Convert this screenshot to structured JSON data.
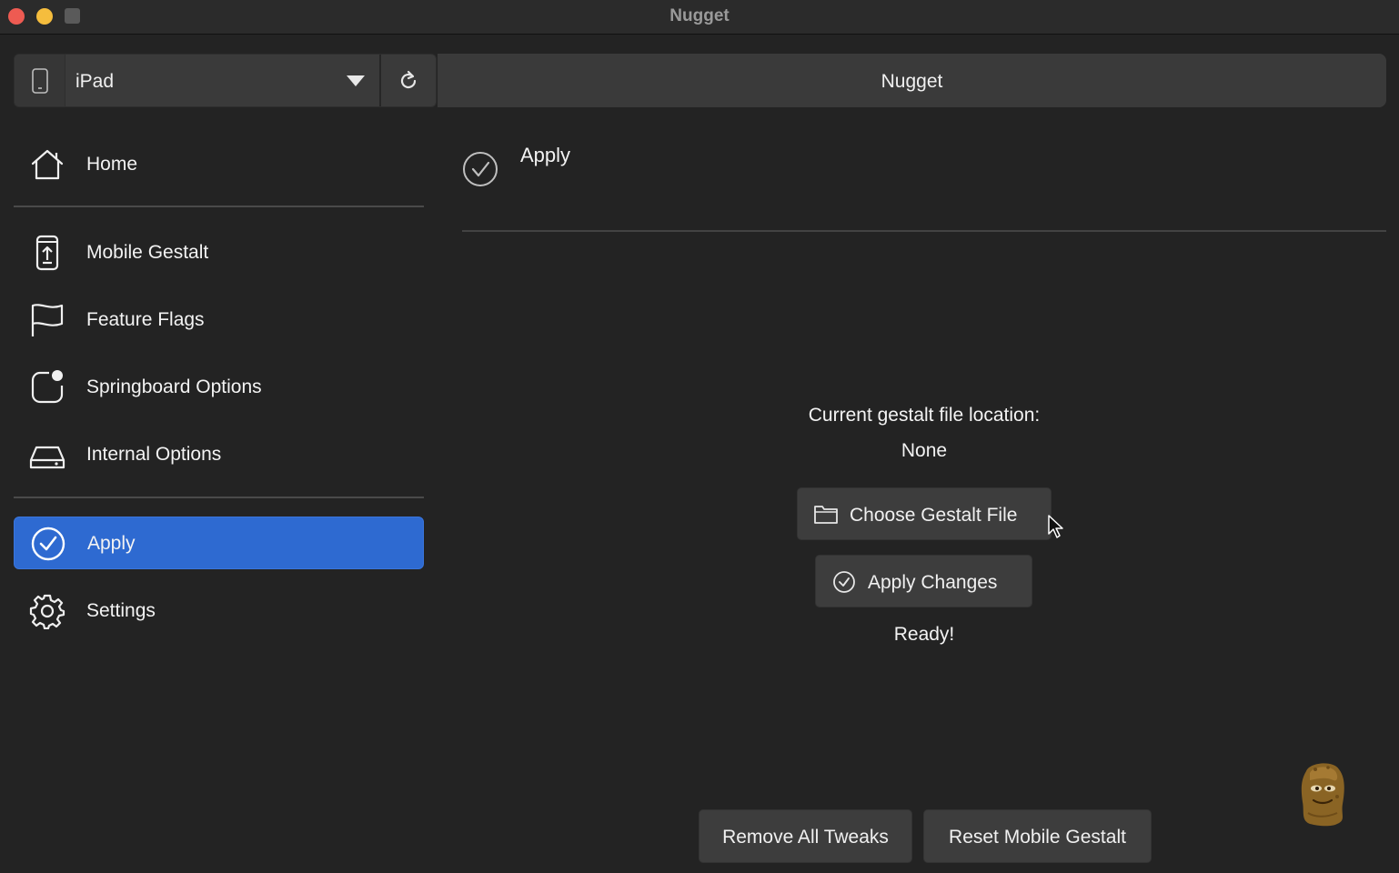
{
  "window": {
    "title": "Nugget"
  },
  "device": {
    "name": "iPad"
  },
  "header": {
    "title": "Nugget"
  },
  "sidebar": {
    "items": [
      {
        "label": "Home",
        "icon": "home-icon"
      },
      {
        "label": "Mobile Gestalt",
        "icon": "phone-upload-icon"
      },
      {
        "label": "Feature Flags",
        "icon": "flag-icon"
      },
      {
        "label": "Springboard Options",
        "icon": "springboard-icon"
      },
      {
        "label": "Internal Options",
        "icon": "drive-icon"
      },
      {
        "label": "Apply",
        "icon": "check-circle-icon",
        "active": true
      },
      {
        "label": "Settings",
        "icon": "gear-icon"
      }
    ]
  },
  "page": {
    "title": "Apply",
    "gestalt_location_label": "Current gestalt file location:",
    "gestalt_location_value": "None",
    "choose_file_label": "Choose Gestalt File",
    "apply_changes_label": "Apply Changes",
    "status": "Ready!",
    "remove_tweaks_label": "Remove All Tweaks",
    "reset_gestalt_label": "Reset Mobile Gestalt"
  },
  "colors": {
    "accent": "#2e6ad1",
    "background": "#232323",
    "button": "#3d3d3d",
    "close": "#ee5b52",
    "minimize": "#f5bd3d"
  }
}
